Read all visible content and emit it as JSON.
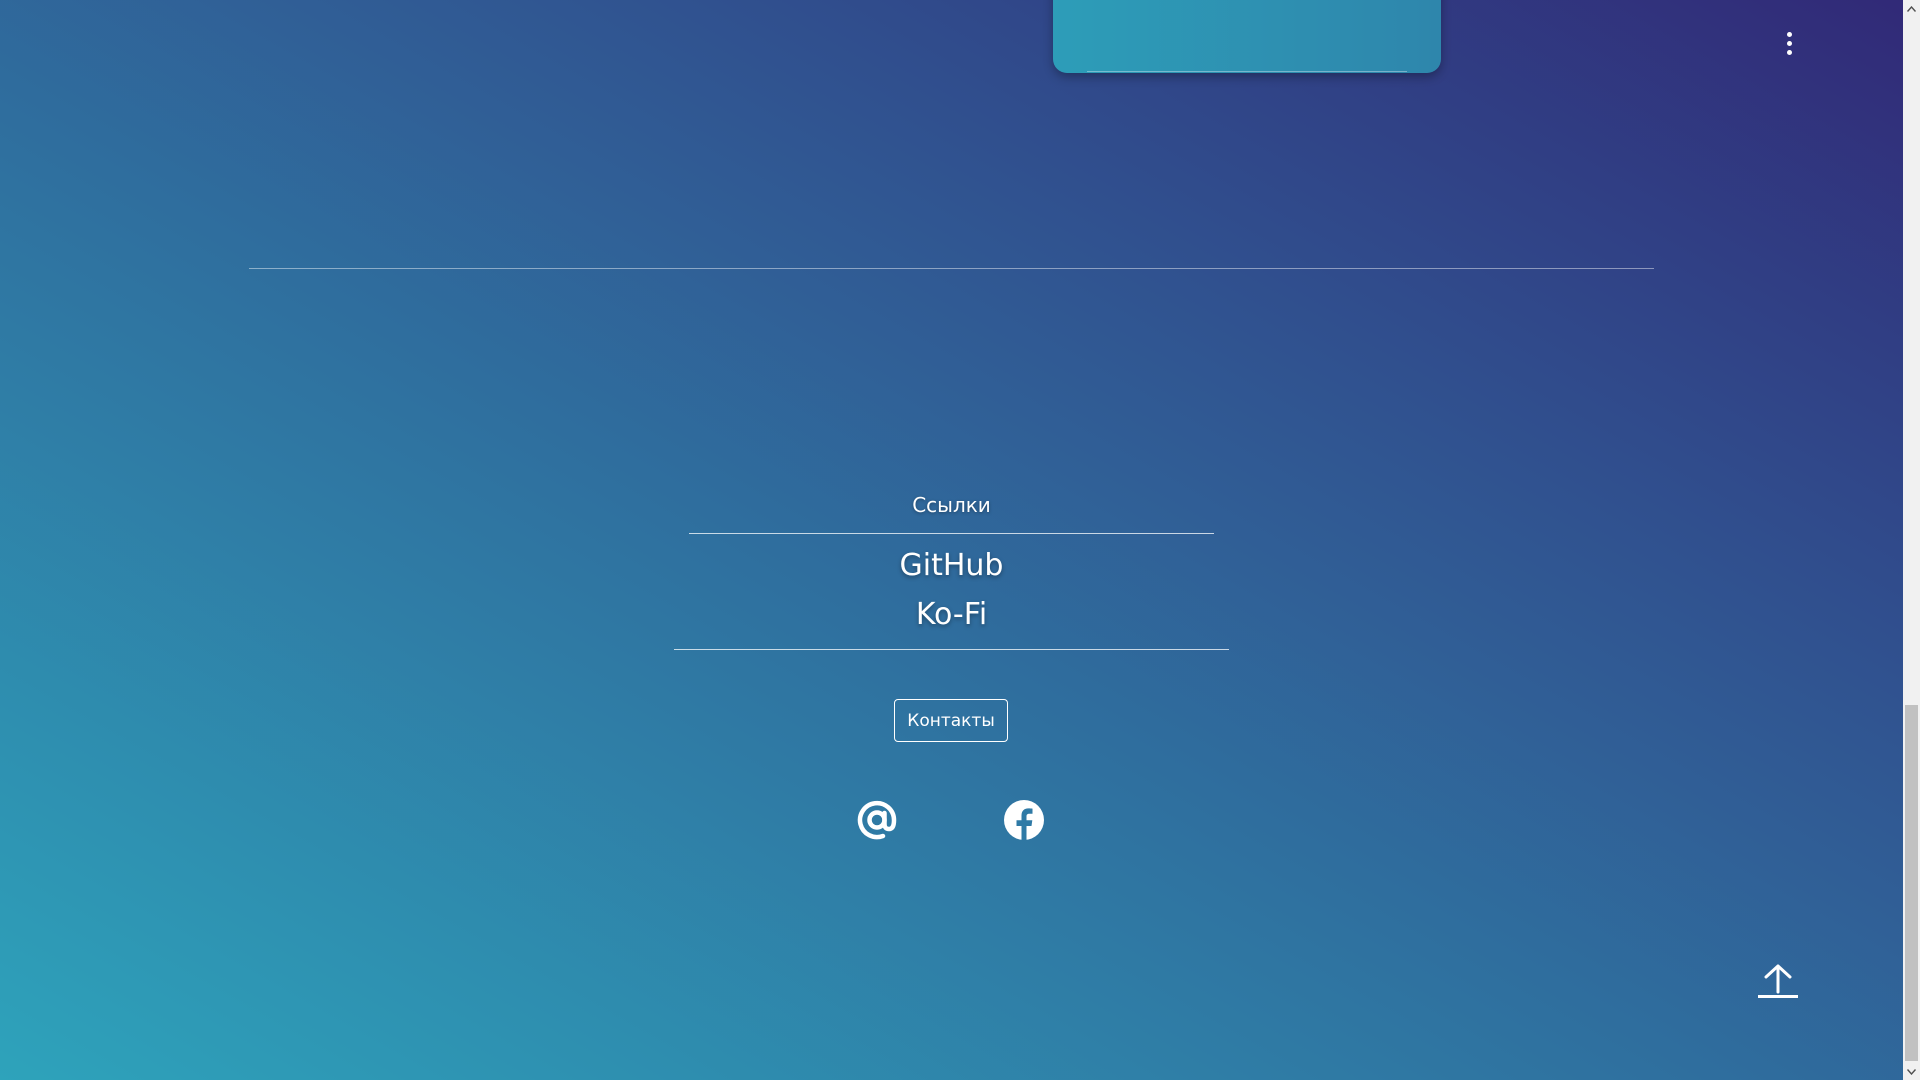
{
  "footer": {
    "links_heading": "Ссылки",
    "links": [
      {
        "label": "GitHub"
      },
      {
        "label": "Ko-Fi"
      }
    ],
    "contacts_button": "Контакты",
    "social": [
      {
        "icon": "at-sign-icon"
      },
      {
        "icon": "facebook-icon"
      }
    ]
  },
  "header": {
    "menu_icon": "kebab-menu-icon"
  },
  "actions": {
    "scroll_top_icon": "arrow-up-icon"
  },
  "colors": {
    "gradient_bottom_left": "#2ea3bb",
    "gradient_top_right": "#312977",
    "text": "#ffffff"
  }
}
